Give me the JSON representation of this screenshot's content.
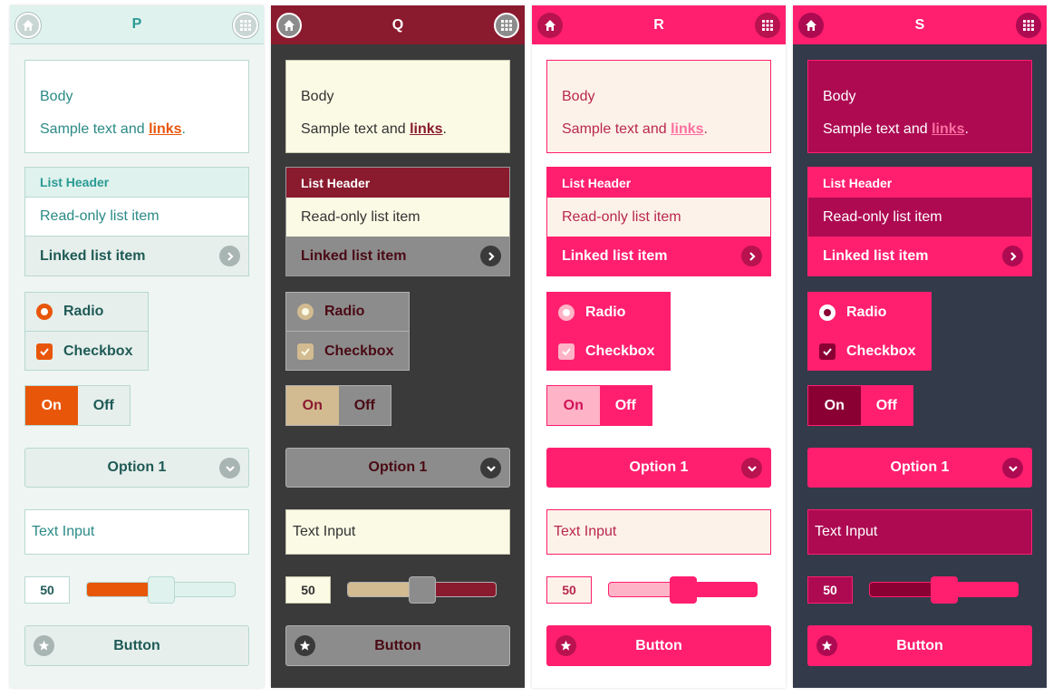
{
  "panels": [
    {
      "id": "p",
      "title": "P",
      "body_heading": "Body",
      "body_text": "Sample text and ",
      "body_link": "links",
      "body_period": ".",
      "list_header": "List Header",
      "list_readonly": "Read-only list item",
      "list_linked": "Linked list item",
      "radio_label": "Radio",
      "checkbox_label": "Checkbox",
      "toggle_on": "On",
      "toggle_off": "Off",
      "select_value": "Option 1",
      "text_input_value": "Text Input",
      "slider_value": "50",
      "button_label": "Button",
      "icons": [
        "home-icon",
        "grid-icon",
        "chevron-right-icon",
        "chevron-down-icon",
        "star-icon",
        "check-icon"
      ]
    },
    {
      "id": "q",
      "title": "Q",
      "body_heading": "Body",
      "body_text": "Sample text and ",
      "body_link": "links",
      "body_period": ".",
      "list_header": "List Header",
      "list_readonly": "Read-only list item",
      "list_linked": "Linked list item",
      "radio_label": "Radio",
      "checkbox_label": "Checkbox",
      "toggle_on": "On",
      "toggle_off": "Off",
      "select_value": "Option 1",
      "text_input_value": "Text Input",
      "slider_value": "50",
      "button_label": "Button"
    },
    {
      "id": "r",
      "title": "R",
      "body_heading": "Body",
      "body_text": "Sample text and ",
      "body_link": "links",
      "body_period": ".",
      "list_header": "List Header",
      "list_readonly": "Read-only list item",
      "list_linked": "Linked list item",
      "radio_label": "Radio",
      "checkbox_label": "Checkbox",
      "toggle_on": "On",
      "toggle_off": "Off",
      "select_value": "Option 1",
      "text_input_value": "Text Input",
      "slider_value": "50",
      "button_label": "Button"
    },
    {
      "id": "s",
      "title": "S",
      "body_heading": "Body",
      "body_text": "Sample text and ",
      "body_link": "links",
      "body_period": ".",
      "list_header": "List Header",
      "list_readonly": "Read-only list item",
      "list_linked": "Linked list item",
      "radio_label": "Radio",
      "checkbox_label": "Checkbox",
      "toggle_on": "On",
      "toggle_off": "Off",
      "select_value": "Option 1",
      "text_input_value": "Text Input",
      "slider_value": "50",
      "button_label": "Button"
    }
  ],
  "slider_fraction": 0.5,
  "theme_colors": {
    "p": {
      "page": "#eef5f2",
      "header": "#dff2ed",
      "accent": "#e8560a",
      "text": "#2a8a86",
      "dark_text": "#1f5a55"
    },
    "q": {
      "page": "#3a3a3a",
      "header": "#8a1a2e",
      "surface": "#fafae5",
      "gray": "#8c8c8c",
      "tan": "#d2bb90"
    },
    "r": {
      "page": "#ffffff",
      "accent": "#ff1f6e",
      "surface": "#fdf2ea",
      "light": "#ffb3c6",
      "text": "#b8284e"
    },
    "s": {
      "page": "#333a4a",
      "accent": "#ff1f6e",
      "deep": "#ad0a52",
      "thumb": "#8a0033"
    }
  }
}
